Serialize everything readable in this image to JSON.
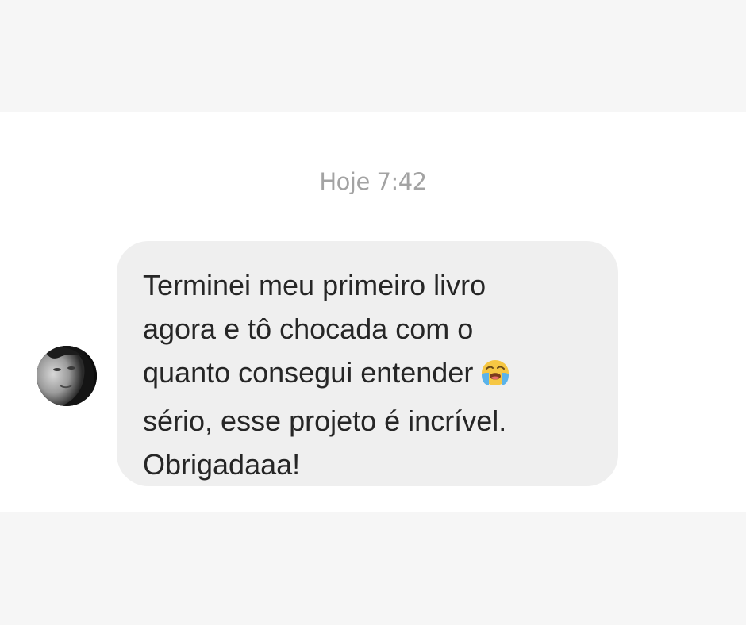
{
  "chat": {
    "timestamp": "Hoje 7:42",
    "message": {
      "sender_avatar": "avatar-photo",
      "lines": [
        "Terminei meu primeiro livro",
        "agora e tô chocada com o",
        "quanto consegui entender",
        "sério, esse projeto é incrível.",
        "Obrigadaaa!"
      ],
      "emoji": "loudly-crying-face-icon"
    }
  },
  "colors": {
    "page_background": "#f6f6f6",
    "panel_background": "#ffffff",
    "bubble_background": "#efefef",
    "message_text": "#262626",
    "timestamp_text": "#a3a3a3"
  }
}
